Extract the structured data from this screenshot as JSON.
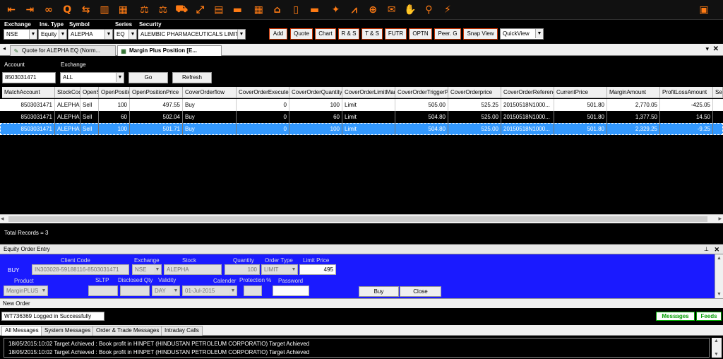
{
  "toolbar": {
    "icons": [
      "exit-icon",
      "sign-out-icon",
      "link-icon",
      "search-icon",
      "swap-icon",
      "book-icon",
      "portfolio-icon",
      "scale-icon",
      "balance-icon",
      "truck-icon",
      "expand-icon",
      "folders-icon",
      "card-icon",
      "calculator-icon",
      "network-icon",
      "document-icon",
      "card2-icon",
      "pin-icon",
      "chart-line-icon",
      "zoom-icon",
      "gift-icon",
      "handshake-icon",
      "key-search-icon",
      "trend-icon"
    ],
    "glyphs": [
      "⇤",
      "⇥",
      "∞",
      "Q",
      "⇆",
      "▥",
      "▦",
      "⚖",
      "⚖",
      "⛟",
      "⤢",
      "▤",
      "▬",
      "▦",
      "⌂",
      "▯",
      "▬",
      "✦",
      "⩘",
      "⊕",
      "✉",
      "✋",
      "⚲",
      "⚡"
    ],
    "right_glyph": "▣"
  },
  "security_bar": {
    "labels": {
      "exchange": "Exchange",
      "ins_type": "Ins. Type",
      "symbol": "Symbol",
      "series": "Series",
      "security": "Security"
    },
    "exchange": "NSE",
    "ins_type": "Equity",
    "symbol": "ALEPHA",
    "series": "EQ",
    "security": "ALEMBIC PHARMACEUTICALS LIMIT",
    "buttons": [
      "Add",
      "Quote",
      "Chart",
      "R & S",
      "T & S",
      "FUTR",
      "OPTN",
      "Peer. G",
      "Snap View"
    ],
    "view_select": "QuickView"
  },
  "tabs": {
    "items": [
      {
        "label": "Quote for ALEPHA EQ (Norm..."
      },
      {
        "label": "Margin Plus Position [E..."
      }
    ],
    "close_glyph": "✕",
    "dropdown_glyph": "▾"
  },
  "filters": {
    "account_label": "Account",
    "account_value": "8503031471",
    "exchange_label": "Exchange",
    "exchange_value": "ALL",
    "go_label": "Go",
    "refresh_label": "Refresh"
  },
  "grid": {
    "columns": [
      "MatchAccount",
      "StockCode",
      "OpenSellBuy",
      "OpenPosition",
      "OpenPositionPrice",
      "CoverOrderflow",
      "CoverOrderExecuted",
      "CoverOrderQuantity",
      "CoverOrderLimitMarket",
      "CoverOrderTriggerPrice",
      "CoverOrderprice",
      "CoverOrderReference",
      "CurrentPrice",
      "MarginAmount",
      "ProfitLossAmount",
      "Se"
    ],
    "rows": [
      [
        "8503031471",
        "ALEPHA",
        "Sell",
        "100",
        "497.55",
        "Buy",
        "0",
        "100",
        "Limit",
        "505.00",
        "525.25",
        "20150518N1000...",
        "501.80",
        "2,770.05",
        "-425.05",
        ""
      ],
      [
        "8503031471",
        "ALEPHA",
        "Sell",
        "60",
        "502.04",
        "Buy",
        "0",
        "60",
        "Limit",
        "504.80",
        "525.00",
        "20150518N1000...",
        "501.80",
        "1,377.50",
        "14.50",
        ""
      ],
      [
        "8503031471",
        "ALEPHA",
        "Sell",
        "100",
        "501.71",
        "Buy",
        "0",
        "100",
        "Limit",
        "504.80",
        "525.00",
        "20150518N1000...",
        "501.80",
        "2,329.25",
        "-9.25",
        ""
      ]
    ],
    "total_records": "Total Records = 3"
  },
  "order_entry": {
    "title": "Equity Order Entry",
    "side": "BUY",
    "labels": {
      "client_code": "Client Code",
      "exchange": "Exchange",
      "stock": "Stock",
      "quantity": "Quantity",
      "order_type": "Order Type",
      "limit_price": "Limit Price",
      "product": "Product",
      "sltp": "SLTP",
      "disclosed_qty": "Disclosed Qty",
      "validity": "Validity",
      "calender": "Calender",
      "protection": "Protection %",
      "password": "Password"
    },
    "client_code": "IN303028-59188116-8503031471",
    "exchange": "NSE",
    "stock": "ALEPHA",
    "quantity": "100",
    "order_type": "LIMIT",
    "limit_price": "495",
    "product": "MarginPLUS",
    "sltp": "",
    "disclosed_qty": "",
    "validity": "DAY",
    "calender": "01-Jul-2015",
    "protection": "",
    "password": "",
    "buy_label": "Buy",
    "close_label": "Close",
    "status": "New Order"
  },
  "message_bar": {
    "login_status": "WT736369 Logged in Successfully",
    "messages_btn": "Messages",
    "feeds_btn": "Feeds"
  },
  "message_tabs": [
    "All Messages",
    "System Messages",
    "Order & Trade Messages",
    "Intraday Calls"
  ],
  "log": [
    "18/05/2015:10:02 Target Achieved : Book profit in HINPET (HINDUSTAN PETROLEUM CORPORATIO) Target Achieved",
    "18/05/2015:10:02 Target Achieved : Book profit in HINPET (HINDUSTAN PETROLEUM CORPORATIO) Target Achieved"
  ],
  "colors": {
    "accent": "#ff7b14",
    "selection": "#3399ff",
    "entry_bg": "#1a1aff",
    "green": "#00aa00"
  }
}
